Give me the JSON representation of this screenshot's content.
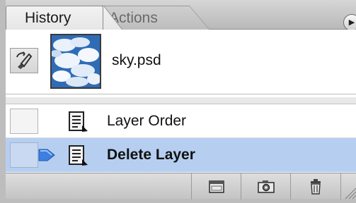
{
  "tabs": [
    {
      "label": "History",
      "active": true
    },
    {
      "label": "Actions",
      "active": false
    }
  ],
  "snapshot": {
    "label": "sky.psd",
    "icon": "history-brush-icon",
    "thumbnail": "sky-clouds-thumbnail"
  },
  "steps": [
    {
      "label": "Layer Order",
      "icon": "history-step-icon",
      "selected": false
    },
    {
      "label": "Delete Layer",
      "icon": "history-step-icon",
      "selected": true
    }
  ],
  "toolbar": {
    "buttons": [
      {
        "name": "new-document-from-state-button",
        "icon": "new-document-icon"
      },
      {
        "name": "new-snapshot-button",
        "icon": "camera-icon"
      },
      {
        "name": "delete-state-button",
        "icon": "trash-icon"
      }
    ]
  },
  "colors": {
    "selected_row": "#b6cff0",
    "state_marker": "#3b7fe0"
  }
}
